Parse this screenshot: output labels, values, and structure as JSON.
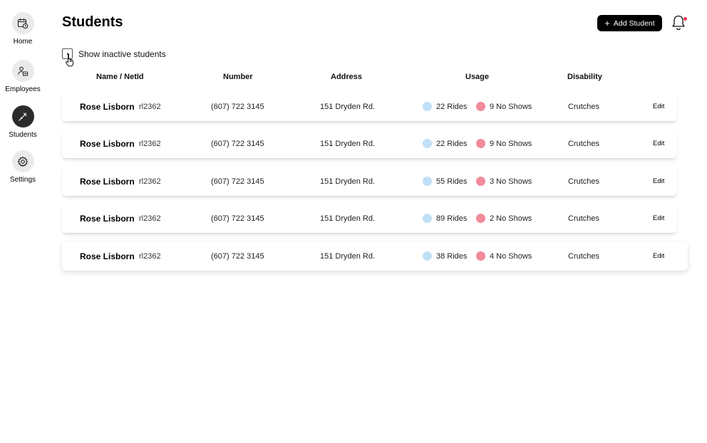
{
  "sidebar": {
    "items": [
      {
        "label": "Home",
        "icon": "calendar-clock-icon",
        "active": false
      },
      {
        "label": "Employees",
        "icon": "employee-badge-icon",
        "active": false
      },
      {
        "label": "Students",
        "icon": "crutch-icon",
        "active": true
      },
      {
        "label": "Settings",
        "icon": "gear-icon",
        "active": false
      }
    ]
  },
  "header": {
    "title": "Students",
    "add_button_label": "Add Student",
    "add_button_icon": "plus-icon",
    "bell_icon": "bell-icon",
    "notification_dot_color": "#e8394f"
  },
  "filter": {
    "show_inactive_label": "Show inactive students",
    "checked": false
  },
  "table": {
    "columns": [
      "Name / NetId",
      "Number",
      "Address",
      "Usage",
      "Disability"
    ],
    "rows": [
      {
        "name": "Rose Lisborn",
        "netid": "rl2362",
        "number": "(607) 722 3145",
        "address": "151 Dryden Rd.",
        "rides": "22 Rides",
        "no_shows": "9 No Shows",
        "disability": "Crutches",
        "edit": "Edit"
      },
      {
        "name": "Rose Lisborn",
        "netid": "rl2362",
        "number": "(607) 722 3145",
        "address": "151 Dryden Rd.",
        "rides": "22 Rides",
        "no_shows": "9 No Shows",
        "disability": "Crutches",
        "edit": "Edit"
      },
      {
        "name": "Rose Lisborn",
        "netid": "rl2362",
        "number": "(607) 722 3145",
        "address": "151 Dryden Rd.",
        "rides": "55 Rides",
        "no_shows": "3 No Shows",
        "disability": "Crutches",
        "edit": "Edit"
      },
      {
        "name": "Rose Lisborn",
        "netid": "rl2362",
        "number": "(607) 722 3145",
        "address": "151 Dryden Rd.",
        "rides": "89 Rides",
        "no_shows": "2 No Shows",
        "disability": "Crutches",
        "edit": "Edit"
      },
      {
        "name": "Rose Lisborn",
        "netid": "rl2362",
        "number": "(607) 722 3145",
        "address": "151 Dryden Rd.",
        "rides": "38 Rides",
        "no_shows": "4 No Shows",
        "disability": "Crutches",
        "edit": "Edit"
      }
    ]
  },
  "colors": {
    "rides_dot": "#bfe0f6",
    "no_shows_dot": "#f28b9b",
    "active_nav": "#2b2b2b",
    "nav_circle": "#eaeaea"
  }
}
